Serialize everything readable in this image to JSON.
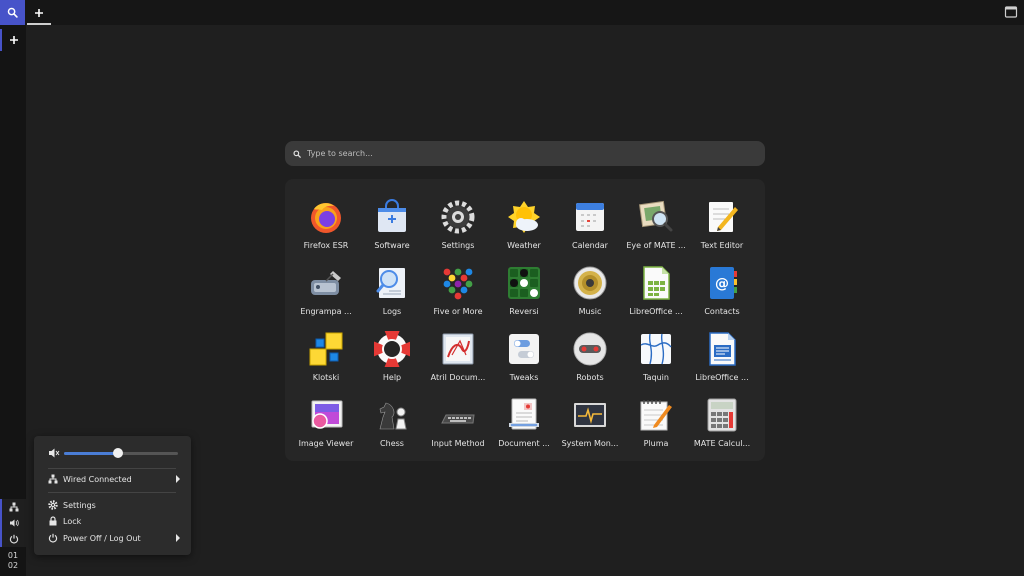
{
  "search": {
    "placeholder": "Type to search..."
  },
  "apps": [
    {
      "label": "Firefox ESR",
      "icon": "firefox-icon"
    },
    {
      "label": "Software",
      "icon": "software-bag-icon"
    },
    {
      "label": "Settings",
      "icon": "gear-icon"
    },
    {
      "label": "Weather",
      "icon": "weather-sun-cloud-icon"
    },
    {
      "label": "Calendar",
      "icon": "calendar-icon"
    },
    {
      "label": "Eye of MATE ...",
      "icon": "image-viewer-magnifier-icon"
    },
    {
      "label": "Text Editor",
      "icon": "text-editor-icon"
    },
    {
      "label": "Engrampa ...",
      "icon": "archive-icon"
    },
    {
      "label": "Logs",
      "icon": "logs-magnifier-icon"
    },
    {
      "label": "Five or More",
      "icon": "five-or-more-icon"
    },
    {
      "label": "Reversi",
      "icon": "reversi-icon"
    },
    {
      "label": "Music",
      "icon": "speaker-icon"
    },
    {
      "label": "LibreOffice ...",
      "icon": "libreoffice-calc-icon"
    },
    {
      "label": "Contacts",
      "icon": "contacts-book-icon"
    },
    {
      "label": "Klotski",
      "icon": "klotski-icon"
    },
    {
      "label": "Help",
      "icon": "lifebuoy-icon"
    },
    {
      "label": "Atril Docum...",
      "icon": "document-viewer-icon"
    },
    {
      "label": "Tweaks",
      "icon": "tweaks-toggle-icon"
    },
    {
      "label": "Robots",
      "icon": "robot-icon"
    },
    {
      "label": "Taquin",
      "icon": "taquin-puzzle-icon"
    },
    {
      "label": "LibreOffice ...",
      "icon": "libreoffice-writer-icon"
    },
    {
      "label": "Image Viewer",
      "icon": "image-viewer-icon"
    },
    {
      "label": "Chess",
      "icon": "chess-icon"
    },
    {
      "label": "Input Method",
      "icon": "keyboard-icon"
    },
    {
      "label": "Document ...",
      "icon": "document-scanner-icon"
    },
    {
      "label": "System Mon...",
      "icon": "system-monitor-icon"
    },
    {
      "label": "Pluma",
      "icon": "pluma-notepad-icon"
    },
    {
      "label": "MATE Calcul...",
      "icon": "calculator-icon"
    }
  ],
  "popup": {
    "volume_level": 0.47,
    "network_label": "Wired Connected",
    "settings_label": "Settings",
    "lock_label": "Lock",
    "power_label": "Power Off / Log Out"
  },
  "clock": {
    "hour": "01",
    "minute": "02"
  },
  "colors": {
    "accent": "#4753c9",
    "slider": "#4a7dd6"
  }
}
